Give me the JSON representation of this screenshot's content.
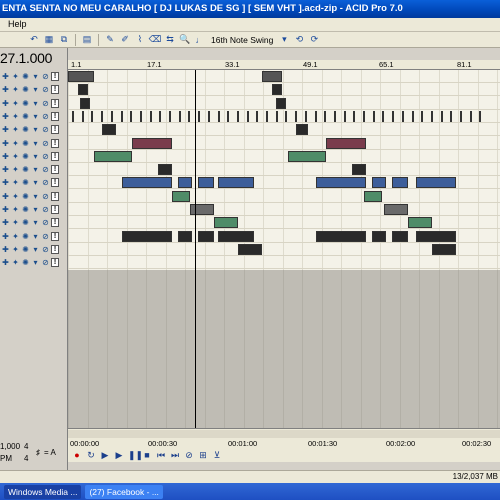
{
  "window": {
    "title": "ENTA SENTA NO MEU CARALHO [ DJ LUKAS DE SG ] [ SEM VHT ].acd-zip - ACID Pro 7.0"
  },
  "menu": {
    "help": "Help"
  },
  "toolbar": {
    "snap_label": "16th Note Swing"
  },
  "timecode": "27.1.000",
  "ruler": [
    "1.1",
    "17.1",
    "33.1",
    "49.1",
    "65.1",
    "81.1"
  ],
  "time_ruler": [
    "00:00:00",
    "00:00:30",
    "00:01:00",
    "00:01:30",
    "00:02:00",
    "00:02:30"
  ],
  "bottom": {
    "tempo": "1,000",
    "bpm_label": "PM",
    "ts_top": "4",
    "ts_bottom": "4",
    "key": "= A"
  },
  "status": {
    "memory": "13/2,037 MB"
  },
  "taskbar": {
    "items": [
      "Windows Media ...",
      "(27) Facebook - ..."
    ]
  },
  "colors": {
    "title_bg": "#0047b8",
    "clip_dark": "#2a2a2a",
    "clip_blue": "#3d5e9a",
    "clip_green": "#4f8c68",
    "clip_red": "#7a3c4c"
  }
}
